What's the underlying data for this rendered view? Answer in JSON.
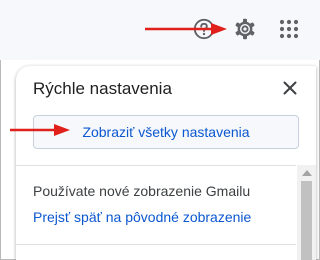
{
  "header": {
    "icons": {
      "help": "help-circle-icon",
      "settings": "gear-icon",
      "apps": "apps-grid-icon"
    }
  },
  "quick_settings": {
    "title": "Rýchle nastavenia",
    "show_all_label": "Zobraziť všetky nastavenia",
    "info_text": "Používate nové zobrazenie Gmailu",
    "revert_link": "Prejsť späť na pôvodné zobrazenie"
  },
  "annotations": {
    "arrow_color": "#e0201a"
  },
  "colors": {
    "link_blue": "#0b57d0",
    "header_bg": "#f6f8fc",
    "icon_gray": "#5f6368"
  }
}
